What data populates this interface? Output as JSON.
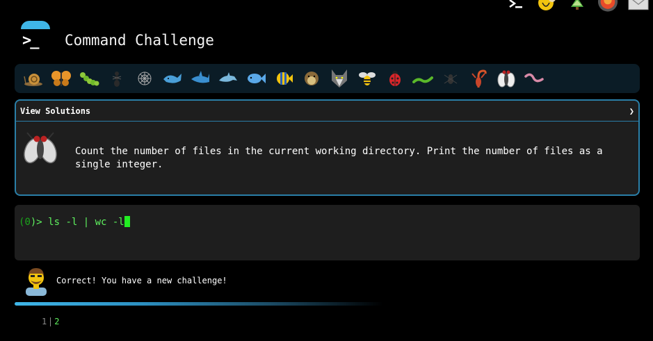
{
  "header": {
    "title": "Command Challenge"
  },
  "bugs": [
    {
      "name": "snail-icon"
    },
    {
      "name": "butterfly-icon"
    },
    {
      "name": "caterpillar-icon"
    },
    {
      "name": "ant-icon"
    },
    {
      "name": "spider-web-icon"
    },
    {
      "name": "whale-icon"
    },
    {
      "name": "shark-icon"
    },
    {
      "name": "dolphin-icon"
    },
    {
      "name": "fish-icon"
    },
    {
      "name": "tropical-fish-icon"
    },
    {
      "name": "blowfish-icon"
    },
    {
      "name": "wolf-icon"
    },
    {
      "name": "bee-icon"
    },
    {
      "name": "ladybug-icon"
    },
    {
      "name": "worm-icon"
    },
    {
      "name": "spider-icon"
    },
    {
      "name": "scorpion-icon"
    },
    {
      "name": "fly-icon"
    },
    {
      "name": "earthworm-icon"
    }
  ],
  "panel": {
    "header_label": "View Solutions",
    "challenge_text": "Count the number of files in the current working directory. Print the number of files as a single integer."
  },
  "terminal": {
    "prompt_open": "(",
    "prompt_status": "0",
    "prompt_close": ")>",
    "command": " ls -l | wc -l"
  },
  "feedback": {
    "message": "Correct! You have a new challenge!"
  },
  "progress": {
    "fraction": 0.58
  },
  "pager": {
    "page1": "1",
    "page2": "2"
  },
  "colors": {
    "accent": "#3fb6e8",
    "prompt_green": "#1aa61a",
    "command_green": "#5ff25f",
    "panel_bg": "#1e1e1e",
    "panel_border": "#2a7fa8"
  }
}
